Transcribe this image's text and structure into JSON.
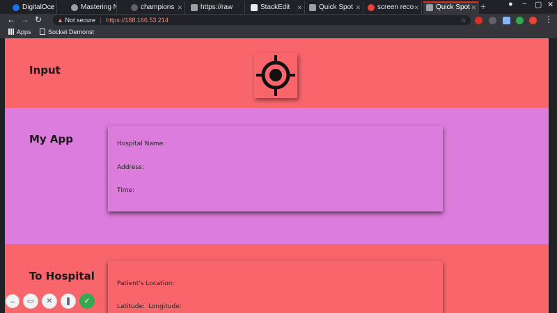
{
  "browser": {
    "tabs": [
      {
        "label": "DigitalOce",
        "color": "#1a73e8"
      },
      {
        "label": "Mastering N",
        "color": "#9aa0a6"
      },
      {
        "label": "champions",
        "color": "#5f6368"
      },
      {
        "label": "https://raw",
        "color": "#9aa0a6"
      },
      {
        "label": "StackEdit",
        "color": "#e8eaed"
      },
      {
        "label": "Quick Spot",
        "color": "#9aa0a6"
      },
      {
        "label": "screen reco",
        "color": "#ea4335"
      },
      {
        "label": "Quick Spot",
        "color": "#9aa0a6",
        "active": true
      }
    ],
    "new_tab_label": "+",
    "security_label": "Not secure",
    "url": "https://188.166.53.214",
    "bookmarks": [
      {
        "label": "Apps"
      },
      {
        "label": "Socket Demonst"
      }
    ],
    "nav": {
      "back": "←",
      "forward": "→",
      "reload": "↻"
    }
  },
  "page": {
    "sections": {
      "input": {
        "title": "Input",
        "icon": "crosshair-icon",
        "color": "#f8666c"
      },
      "app": {
        "title": "My App",
        "color": "#dc7cdc",
        "fields": {
          "hospital_name": "Hospital Name:",
          "address": "Address:",
          "time": "Time:"
        }
      },
      "hospital": {
        "title": "To Hospital",
        "color": "#f8666c",
        "fields": {
          "patient_location": "Patient's Location:",
          "latitude": "Latitude:",
          "longitude": "Longitude:"
        }
      }
    }
  },
  "recorder_toolbar": {
    "buttons": [
      {
        "name": "minimize-icon",
        "glyph": "–"
      },
      {
        "name": "camera-icon",
        "glyph": "▭"
      },
      {
        "name": "close-icon",
        "glyph": "✕"
      },
      {
        "name": "pause-icon",
        "glyph": "❚"
      },
      {
        "name": "check-icon",
        "glyph": "✓"
      }
    ]
  }
}
